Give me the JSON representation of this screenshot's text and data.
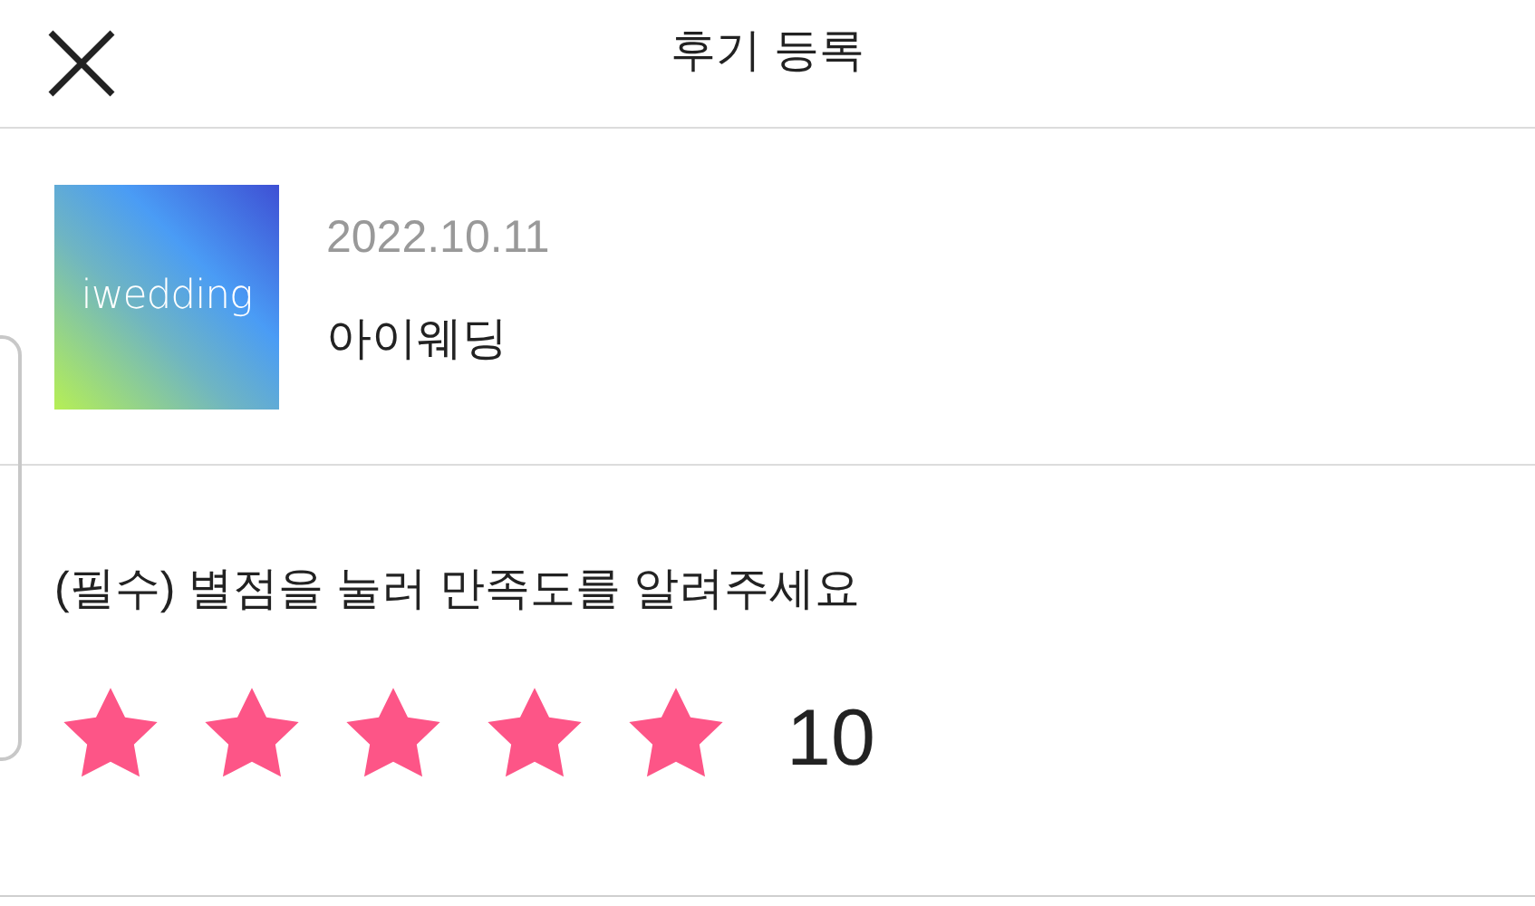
{
  "header": {
    "title": "후기 등록"
  },
  "product": {
    "logo_text": "iwedding",
    "date": "2022.10.11",
    "name": "아이웨딩"
  },
  "rating": {
    "prompt": "(필수) 별점을 눌러 만족도를 알려주세요",
    "stars": 5,
    "score": "10"
  }
}
